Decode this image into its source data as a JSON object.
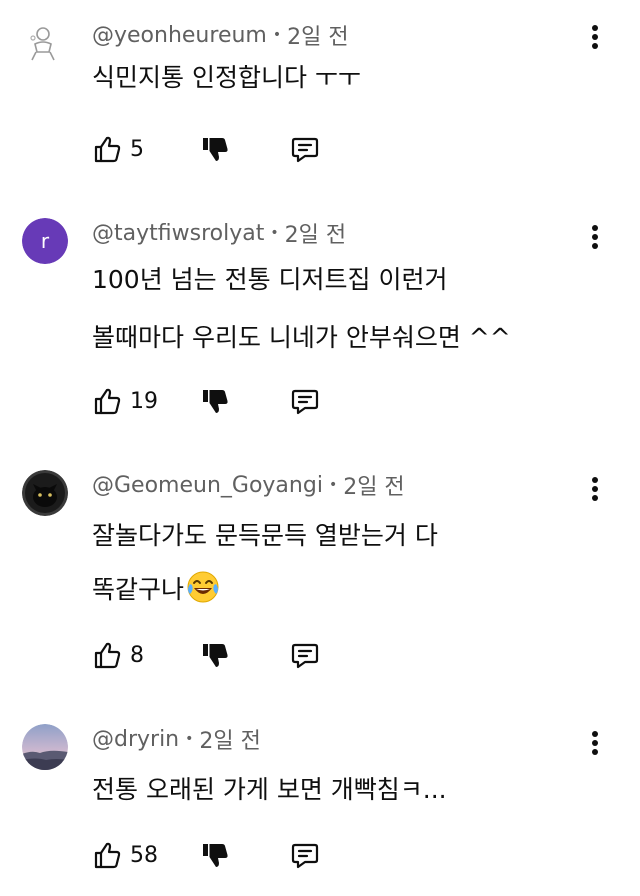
{
  "comments": [
    {
      "username": "@yeonheureum",
      "time": "2일 전",
      "lines": [
        "식민지통 인정합니다 ㅜㅜ"
      ],
      "likes": "5",
      "avatar": "default-outline"
    },
    {
      "username": "@taytfiwsrolyat",
      "time": "2일 전",
      "lines": [
        "100년 넘는 전통 디저트집 이런거",
        "볼때마다 우리도 니네가 안부숴으면 ^^"
      ],
      "likes": "19",
      "avatar": "letter",
      "avatar_letter": "r",
      "avatar_color": "#673ab7"
    },
    {
      "username": "@Geomeun_Goyangi",
      "time": "2일 전",
      "lines": [
        "잘놀다가도 문득문득 열받는거 다",
        "똑같구나"
      ],
      "likes": "8",
      "avatar": "black-cat"
    },
    {
      "username": "@dryrin",
      "time": "2일 전",
      "lines": [
        "전통 오래된 가게 보면 개빡침ㅋ..."
      ],
      "likes": "58",
      "avatar": "sunset-landscape"
    }
  ],
  "colors": {
    "text_primary": "#0f0f0f",
    "text_secondary": "#606060",
    "avatar_purple": "#673ab7"
  },
  "icons": {
    "like": "thumbs-up-outline-icon",
    "dislike": "thumbs-down-filled-icon",
    "reply": "comment-icon",
    "more": "vertical-dots-icon",
    "emoji": "tears-of-joy-emoji"
  }
}
